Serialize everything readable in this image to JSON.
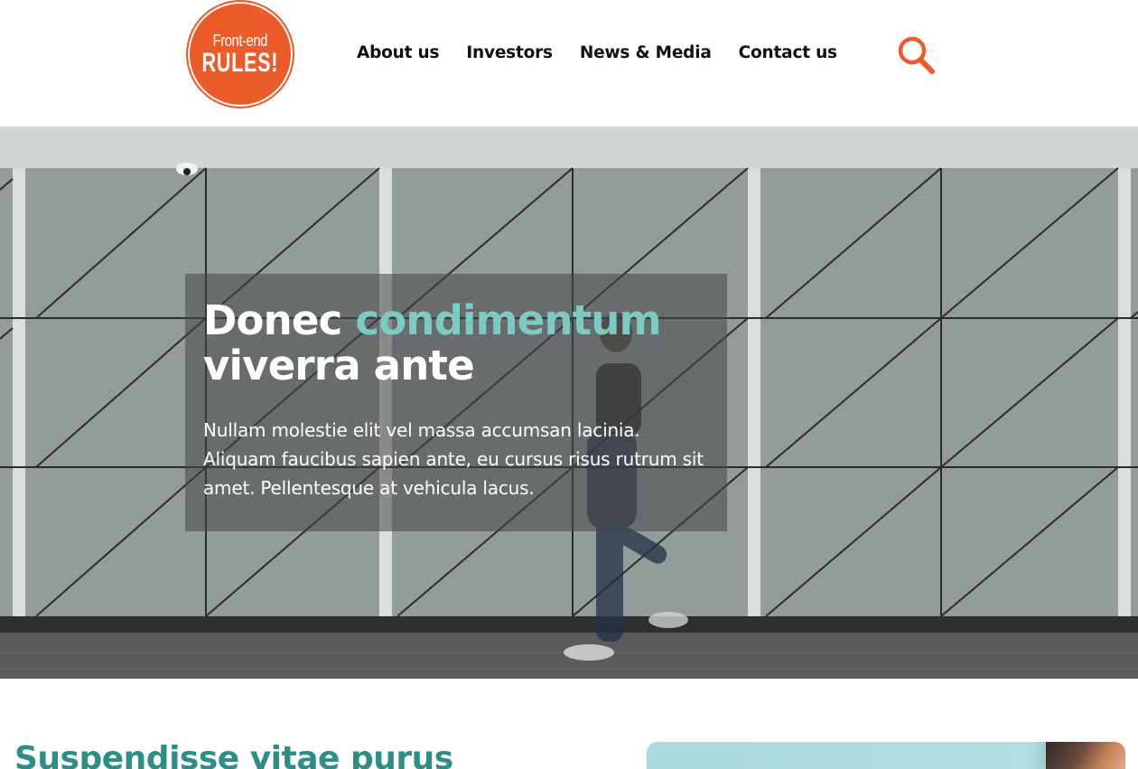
{
  "header": {
    "logo": {
      "line1": "Front-end",
      "line2": "RULES!",
      "color": "#ec5b2a"
    },
    "nav": [
      {
        "label": "About us"
      },
      {
        "label": "Investors"
      },
      {
        "label": "News & Media"
      },
      {
        "label": "Contact us"
      }
    ],
    "search_icon": "search-icon"
  },
  "hero": {
    "title_part1": "Donec ",
    "title_accent": "condimentum",
    "title_part2": "viverra ante",
    "text": "Nullam molestie elit vel massa accumsan lacinia. Aliquam faucibus sapien ante, eu cursus risus rutrum sit amet. Pellentesque at vehicula lacus.",
    "accent_color": "#7ccbc2"
  },
  "section": {
    "title": "Suspendisse vitae purus",
    "title_color": "#2e8e86"
  }
}
